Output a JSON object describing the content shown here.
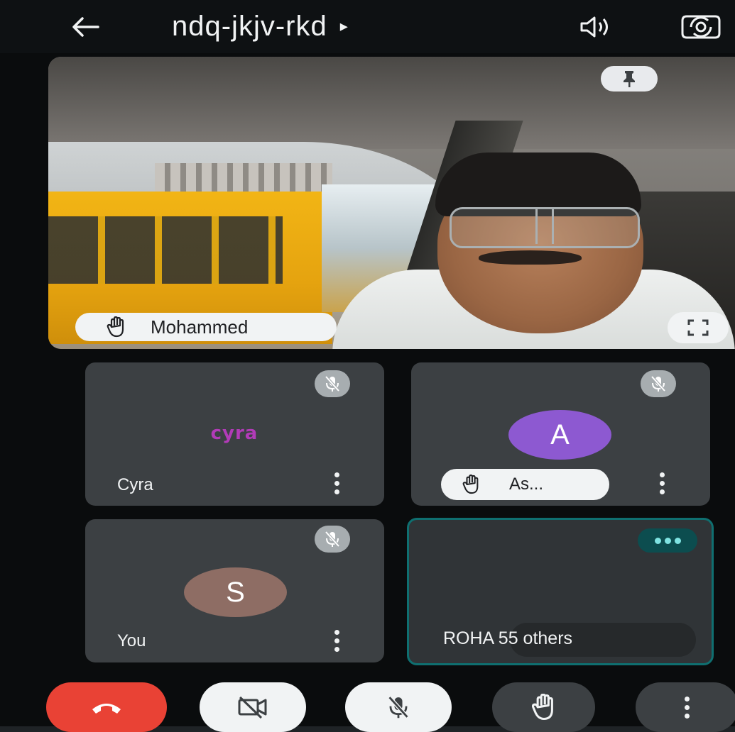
{
  "header": {
    "meeting_code": "ndq-jkjv-rkd",
    "caret": "▸"
  },
  "main_video": {
    "participant_name": "Mohammed",
    "hand_raised": true,
    "pinned": true
  },
  "tiles": [
    {
      "name": "Cyra",
      "logo_text": "cyra",
      "muted": true
    },
    {
      "name": "As...",
      "avatar_letter": "A",
      "muted": true,
      "hand_raised": true
    },
    {
      "name": "You",
      "avatar_letter": "S",
      "muted": true
    },
    {
      "name": "ROHAN",
      "others_label": "55 others"
    }
  ],
  "others_text": "ROHA 55 others",
  "colors": {
    "end_call": "#e94235",
    "avatar_a": "#8d59d1",
    "avatar_s": "#8e6d64",
    "active_border": "#0f6f70",
    "cyra_brand": "#b23bb8"
  },
  "icons": [
    "back-arrow-icon",
    "speaker-icon",
    "switch-camera-icon",
    "pin-icon",
    "raised-hand-icon",
    "fullscreen-icon",
    "mic-off-icon",
    "more-vert-icon",
    "end-call-icon",
    "camera-off-icon"
  ]
}
